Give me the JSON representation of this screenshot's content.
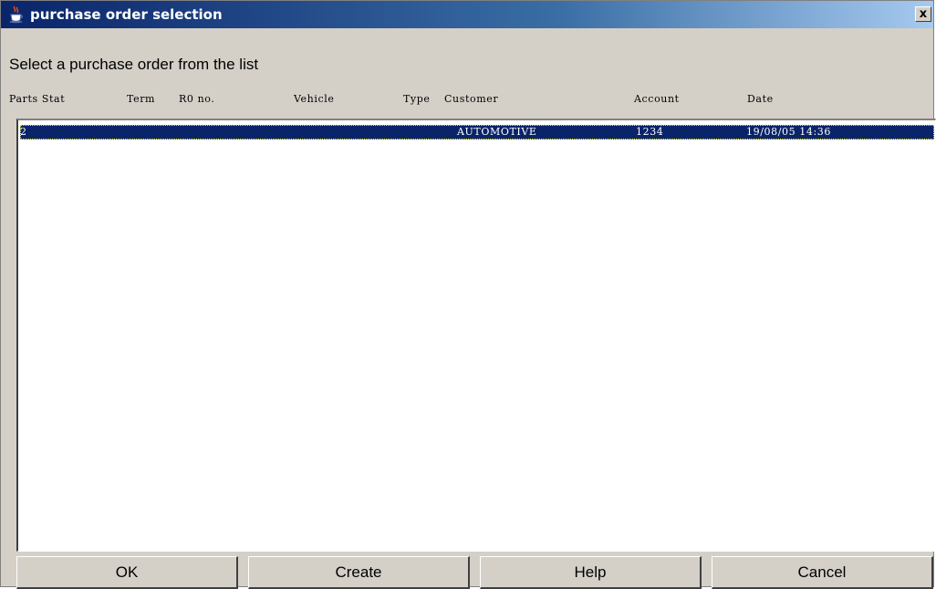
{
  "window": {
    "title": "purchase order selection",
    "close_label": "x"
  },
  "prompt": "Select a purchase order from the list",
  "columns": [
    "Parts Stat",
    "Term",
    "R0 no.",
    "Vehicle",
    "Type",
    "Customer",
    "Account",
    "Date"
  ],
  "rows": [
    {
      "parts_stat": "2",
      "term": "",
      "ro_no": "",
      "vehicle": "",
      "type": "",
      "customer": "AUTOMOTIVE",
      "account": "1234",
      "date": "19/08/05 14:36",
      "selected": true
    }
  ],
  "buttons": {
    "ok": "OK",
    "create": "Create",
    "help": "Help",
    "cancel": "Cancel"
  },
  "colors": {
    "title_bar_start": "#0a246a",
    "title_bar_end": "#a6caf0",
    "selection": "#0a246a",
    "dialog_bg": "#d4d0c8"
  },
  "icons": {
    "title": "java-cup-icon",
    "close": "close-icon"
  }
}
